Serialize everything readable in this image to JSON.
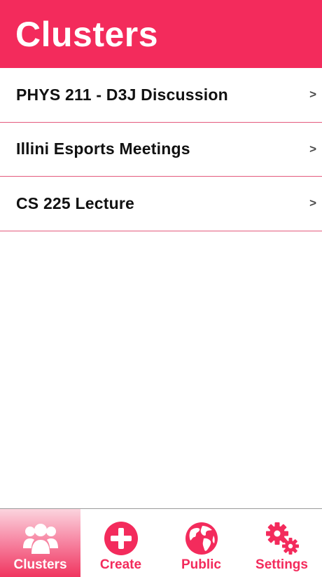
{
  "header": {
    "title": "Clusters"
  },
  "clusters": [
    {
      "label": "PHYS 211 - D3J Discussion",
      "chevron": ">"
    },
    {
      "label": "Illini Esports Meetings",
      "chevron": ">"
    },
    {
      "label": "CS 225 Lecture",
      "chevron": ">"
    }
  ],
  "tabs": [
    {
      "label": "Clusters",
      "icon": "users-icon",
      "active": true
    },
    {
      "label": "Create",
      "icon": "plus-circle-icon",
      "active": false
    },
    {
      "label": "Public",
      "icon": "globe-icon",
      "active": false
    },
    {
      "label": "Settings",
      "icon": "gears-icon",
      "active": false
    }
  ],
  "colors": {
    "accent": "#f32b5c",
    "divider": "#e35a7d",
    "tab_border": "#9b9b9b"
  }
}
